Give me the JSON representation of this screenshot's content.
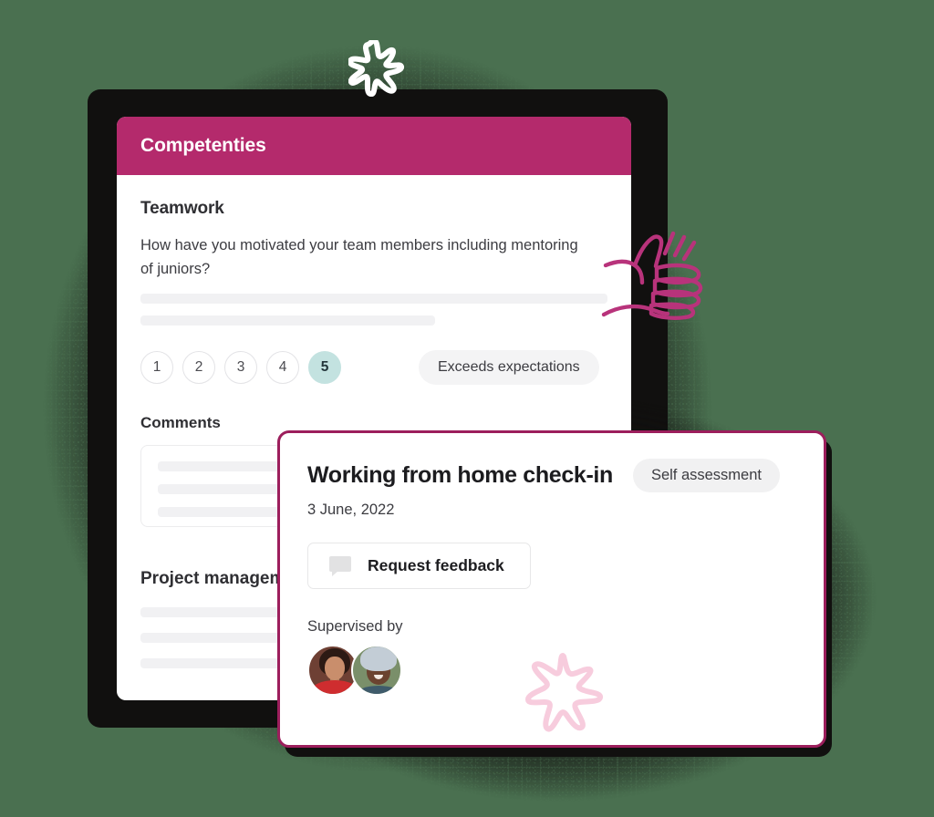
{
  "theme": {
    "page_background": "#4a7050",
    "header_magenta": "#b42a6c",
    "front_card_border": "#9c1e5c",
    "selected_rating_teal": "#c3e2e0",
    "doodle_pink": "#b8337b",
    "doodle_light_pink": "#f7ccdd",
    "skeleton_gray": "#f1f1f3"
  },
  "back_card": {
    "header": {
      "title": "Competenties"
    },
    "competency": {
      "title": "Teamwork",
      "question": "How have you motivated your team members including mentoring of juniors?",
      "answer_skeleton_widths": [
        "100%",
        "63%"
      ],
      "rating": {
        "options": [
          "1",
          "2",
          "3",
          "4",
          "5"
        ],
        "selected": "5",
        "label": "Exceeds expectations"
      },
      "comments": {
        "label": "Comments",
        "skeleton_widths": [
          "86%",
          "86%",
          "58%"
        ]
      }
    },
    "competency_2": {
      "title": "Project management",
      "skeleton_widths": [
        "100%",
        "100%",
        "100%"
      ]
    }
  },
  "front_card": {
    "title": "Working from home check-in",
    "badge": "Self assessment",
    "date": "3 June, 2022",
    "request_feedback_button": {
      "label": "Request feedback",
      "icon": "speech-bubble-icon"
    },
    "supervised_by": {
      "label": "Supervised by",
      "avatars": [
        "avatar-supervisor-1",
        "avatar-supervisor-2"
      ]
    }
  },
  "decorations": {
    "sparkle_top": "white-sparkle-doodle",
    "thumbs_up": "pink-thumbs-up-doodle",
    "star": "pink-star-doodle"
  }
}
